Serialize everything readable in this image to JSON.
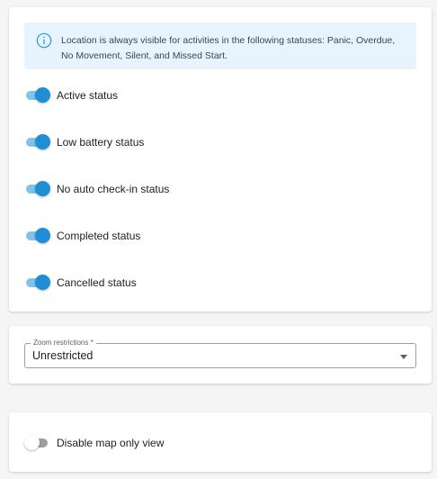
{
  "info_alert": {
    "icon": "info-circle-icon",
    "text": "Location is always visible for activities in the following statuses: Panic, Overdue, No Movement, Silent, and Missed Start."
  },
  "status_toggles": [
    {
      "label": "Active status",
      "checked": true
    },
    {
      "label": "Low battery status",
      "checked": true
    },
    {
      "label": "No auto check-in status",
      "checked": true
    },
    {
      "label": "Completed status",
      "checked": true
    },
    {
      "label": "Cancelled status",
      "checked": true
    }
  ],
  "zoom": {
    "label": "Zoom restrictions *",
    "value": "Unrestricted"
  },
  "map_only": {
    "label": "Disable map only view",
    "checked": false
  },
  "colors": {
    "accent": "#1e8fd6",
    "accent_track": "#7fc3ec",
    "info_bg": "#e8f4fd"
  }
}
